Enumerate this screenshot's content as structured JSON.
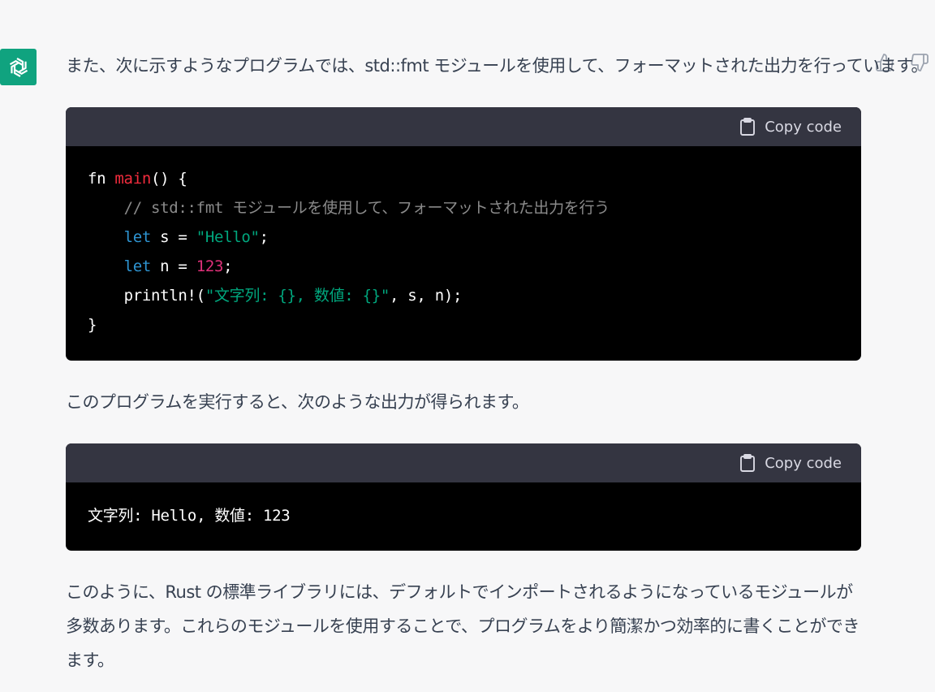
{
  "message": {
    "intro": "また、次に示すようなプログラムでは、std::fmt モジュールを使用して、フォーマットされた出力を行っています。",
    "after_code": "このプログラムを実行すると、次のような出力が得られます。",
    "conclusion": "このように、Rust の標準ライブラリには、デフォルトでインポートされるようになっているモジュールが多数あります。これらのモジュールを使用することで、プログラムをより簡潔かつ効率的に書くことができます。"
  },
  "code_blocks": [
    {
      "copy_label": "Copy code",
      "lines": {
        "l1_fn": "fn",
        "l1_name": "main",
        "l1_rest": "() {",
        "l2_comment": "// std::fmt モジュールを使用して、フォーマットされた出力を行う",
        "l3_let": "let",
        "l3_mid": " s = ",
        "l3_str": "\"Hello\"",
        "l3_end": ";",
        "l4_let": "let",
        "l4_mid": " n = ",
        "l4_num": "123",
        "l4_end": ";",
        "l5_macro": "println!(",
        "l5_str": "\"文字列: {}, 数値: {}\"",
        "l5_end": ", s, n);",
        "l6": "}"
      }
    },
    {
      "copy_label": "Copy code",
      "output": "文字列: Hello, 数値: 123"
    }
  ],
  "icons": {
    "avatar": "openai-logo-icon",
    "thumbs_up": "thumbs-up-icon",
    "thumbs_down": "thumbs-down-icon",
    "copy": "clipboard-icon"
  },
  "colors": {
    "avatar_bg": "#10a37f",
    "code_header_bg": "#343541",
    "code_bg": "#000000",
    "page_bg": "#f7f7f8"
  }
}
